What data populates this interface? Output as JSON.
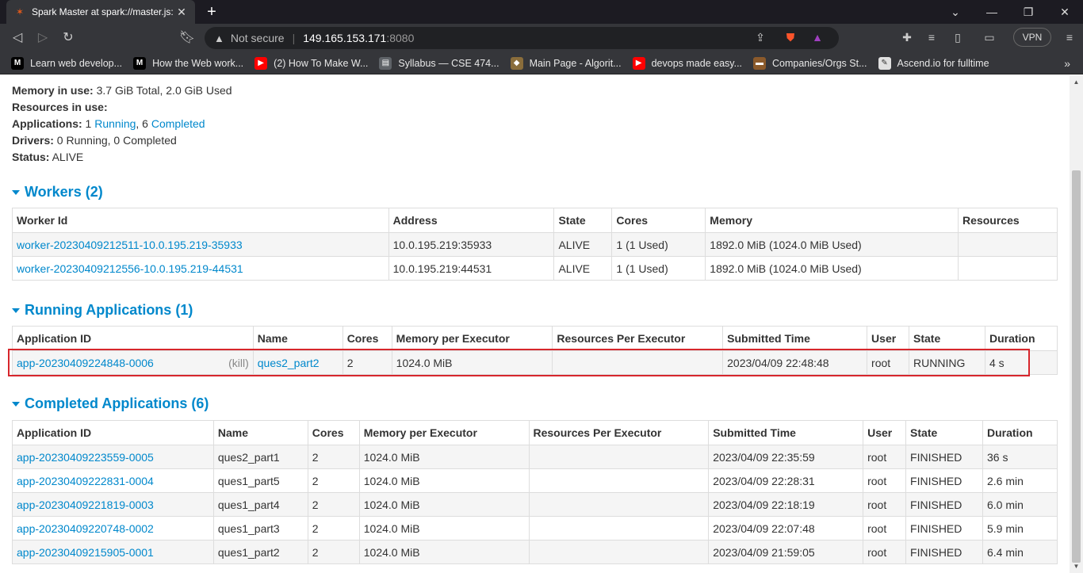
{
  "browser": {
    "tab_title": "Spark Master at spark://master.js:",
    "tab_favicon": "spark-star-icon",
    "url_warning": "Not secure",
    "url_host": "149.165.153.171",
    "url_port": ":8080",
    "vpn_label": "VPN",
    "bookmarks": [
      {
        "label": "Learn web develop...",
        "icon": "mdn-icon",
        "color": "#000000"
      },
      {
        "label": "How the Web work...",
        "icon": "medium-icon",
        "color": "#000000"
      },
      {
        "label": "(2) How To Make W...",
        "icon": "youtube-icon",
        "color": "#ff0000"
      },
      {
        "label": "Syllabus — CSE 474...",
        "icon": "doc-icon",
        "color": "#5f6368"
      },
      {
        "label": "Main Page - Algorit...",
        "icon": "algo-icon",
        "color": "#8a6d3b"
      },
      {
        "label": "devops made easy...",
        "icon": "youtube-icon",
        "color": "#ff0000"
      },
      {
        "label": "Companies/Orgs St...",
        "icon": "briefcase-icon",
        "color": "#8b5a2b"
      },
      {
        "label": "Ascend.io for fulltime",
        "icon": "pen-icon",
        "color": "#e0e0e0"
      }
    ]
  },
  "summary": {
    "memory_label": "Memory in use:",
    "memory_value": " 3.7 GiB Total, 2.0 GiB Used",
    "resources_label": "Resources in use:",
    "apps_label": "Applications:",
    "apps_running_count": " 1 ",
    "apps_running_link": "Running",
    "apps_sep": ", 6 ",
    "apps_completed_link": "Completed",
    "drivers_label": "Drivers:",
    "drivers_value": " 0 Running, 0 Completed",
    "status_label": "Status:",
    "status_value": " ALIVE"
  },
  "workers": {
    "heading": "Workers (2)",
    "columns": [
      "Worker Id",
      "Address",
      "State",
      "Cores",
      "Memory",
      "Resources"
    ],
    "rows": [
      {
        "id": "worker-20230409212511-10.0.195.219-35933",
        "address": "10.0.195.219:35933",
        "state": "ALIVE",
        "cores": "1 (1 Used)",
        "memory": "1892.0 MiB (1024.0 MiB Used)",
        "resources": ""
      },
      {
        "id": "worker-20230409212556-10.0.195.219-44531",
        "address": "10.0.195.219:44531",
        "state": "ALIVE",
        "cores": "1 (1 Used)",
        "memory": "1892.0 MiB (1024.0 MiB Used)",
        "resources": ""
      }
    ]
  },
  "running": {
    "heading": "Running Applications (1)",
    "columns": [
      "Application ID",
      "Name",
      "Cores",
      "Memory per Executor",
      "Resources Per Executor",
      "Submitted Time",
      "User",
      "State",
      "Duration"
    ],
    "rows": [
      {
        "id": "app-20230409224848-0006",
        "kill": "(kill)",
        "name": "ques2_part2",
        "cores": "2",
        "memory": "1024.0 MiB",
        "resources": "",
        "submitted": "2023/04/09 22:48:48",
        "user": "root",
        "state": "RUNNING",
        "duration": "4 s"
      }
    ]
  },
  "completed": {
    "heading": "Completed Applications (6)",
    "columns": [
      "Application ID",
      "Name",
      "Cores",
      "Memory per Executor",
      "Resources Per Executor",
      "Submitted Time",
      "User",
      "State",
      "Duration"
    ],
    "rows": [
      {
        "id": "app-20230409223559-0005",
        "name": "ques2_part1",
        "cores": "2",
        "memory": "1024.0 MiB",
        "resources": "",
        "submitted": "2023/04/09 22:35:59",
        "user": "root",
        "state": "FINISHED",
        "duration": "36 s"
      },
      {
        "id": "app-20230409222831-0004",
        "name": "ques1_part5",
        "cores": "2",
        "memory": "1024.0 MiB",
        "resources": "",
        "submitted": "2023/04/09 22:28:31",
        "user": "root",
        "state": "FINISHED",
        "duration": "2.6 min"
      },
      {
        "id": "app-20230409221819-0003",
        "name": "ques1_part4",
        "cores": "2",
        "memory": "1024.0 MiB",
        "resources": "",
        "submitted": "2023/04/09 22:18:19",
        "user": "root",
        "state": "FINISHED",
        "duration": "6.0 min"
      },
      {
        "id": "app-20230409220748-0002",
        "name": "ques1_part3",
        "cores": "2",
        "memory": "1024.0 MiB",
        "resources": "",
        "submitted": "2023/04/09 22:07:48",
        "user": "root",
        "state": "FINISHED",
        "duration": "5.9 min"
      },
      {
        "id": "app-20230409215905-0001",
        "name": "ques1_part2",
        "cores": "2",
        "memory": "1024.0 MiB",
        "resources": "",
        "submitted": "2023/04/09 21:59:05",
        "user": "root",
        "state": "FINISHED",
        "duration": "6.4 min"
      }
    ]
  },
  "colors": {
    "link": "#0088cc",
    "highlight_border": "#d7262c",
    "row_alt": "#f5f5f5"
  }
}
